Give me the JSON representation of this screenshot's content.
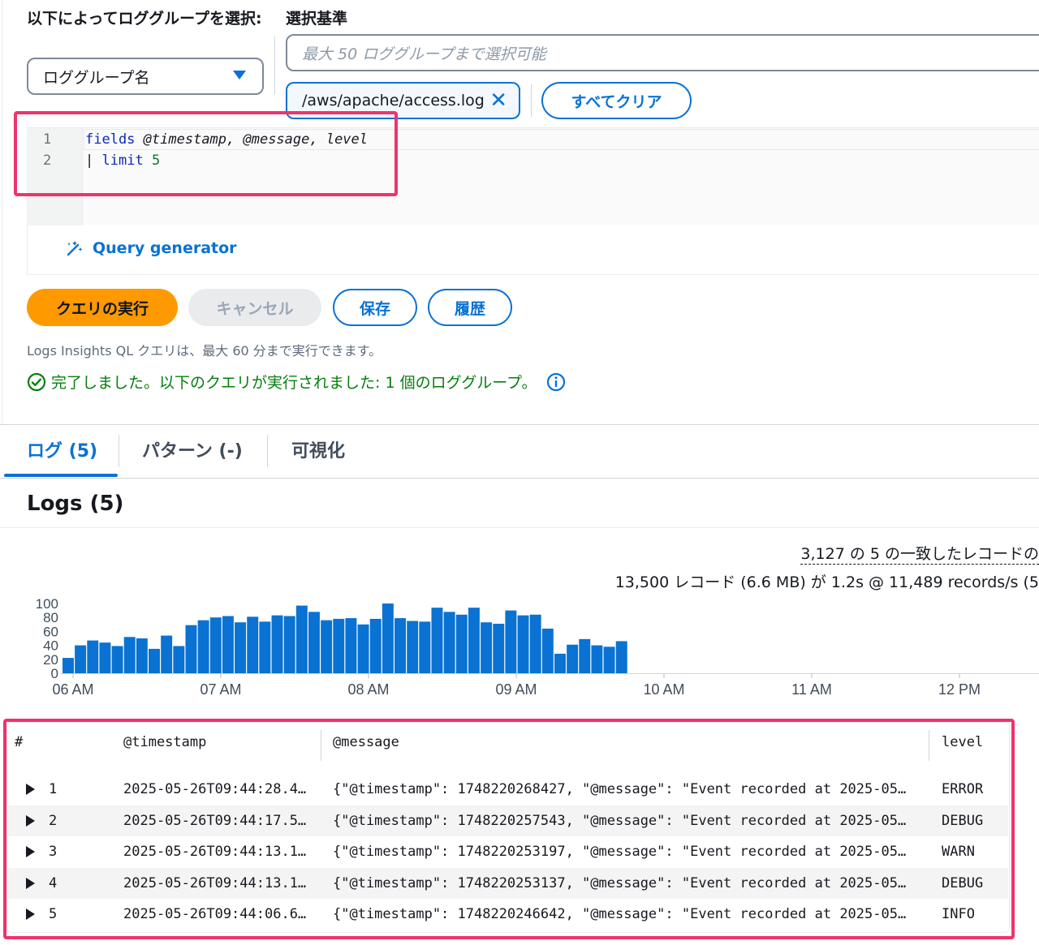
{
  "header": {
    "select_by_label": "以下によってロググループを選択:",
    "selection_criteria_label": "選択基準",
    "select_value": "ロググループ名",
    "search_placeholder": "最大 50 ロググループまで選択可能",
    "token_label": "/aws/apache/access.log",
    "clear_all_label": "すべてクリア"
  },
  "editor": {
    "line_numbers": [
      "1",
      "2"
    ],
    "line1": {
      "keyword": "fields",
      "args": "@timestamp, @message, level"
    },
    "line2": {
      "pipe": "|",
      "keyword": "limit",
      "value": "5"
    },
    "query_generator_label": "Query generator"
  },
  "actions": {
    "run_label": "クエリの実行",
    "cancel_label": "キャンセル",
    "save_label": "保存",
    "history_label": "履歴"
  },
  "hint_text": "Logs Insights QL クエリは、最大 60 分まで実行できます。",
  "status": {
    "message": "完了しました。以下のクエリが実行されました: 1 個のロググループ。",
    "color": "#037f0c"
  },
  "tabs": [
    {
      "label": "ログ (5)",
      "active": true
    },
    {
      "label": "パターン (-)",
      "active": false
    },
    {
      "label": "可視化",
      "active": false
    }
  ],
  "logs": {
    "title": "Logs (5)",
    "summary_line1": "3,127 の 5 の一致したレコードの",
    "summary_line2": "13,500 レコード (6.6 MB) が 1.2s @ 11,489 records/s (5"
  },
  "chart_data": {
    "type": "bar",
    "y_ticks": [
      "100",
      "80",
      "60",
      "40",
      "20",
      "0"
    ],
    "ylim": [
      0,
      100
    ],
    "x_ticks": [
      "06 AM",
      "07 AM",
      "08 AM",
      "09 AM",
      "10 AM",
      "11 AM",
      "12 PM"
    ],
    "values": [
      22,
      40,
      47,
      44,
      39,
      52,
      50,
      35,
      54,
      39,
      69,
      76,
      80,
      82,
      73,
      81,
      74,
      83,
      82,
      97,
      88,
      76,
      78,
      79,
      70,
      78,
      100,
      79,
      75,
      74,
      94,
      88,
      84,
      94,
      73,
      71,
      90,
      83,
      84,
      64,
      28,
      41,
      49,
      40,
      38,
      46
    ],
    "bar_color": "#0972d3",
    "grid": false
  },
  "table": {
    "columns": [
      "#",
      "@timestamp",
      "@message",
      "level"
    ],
    "rows": [
      {
        "index": "1",
        "timestamp": "2025-05-26T09:44:28.4…",
        "message": "{\"@timestamp\": 1748220268427, \"@message\": \"Event recorded at 2025-05…",
        "level": "ERROR"
      },
      {
        "index": "2",
        "timestamp": "2025-05-26T09:44:17.5…",
        "message": "{\"@timestamp\": 1748220257543, \"@message\": \"Event recorded at 2025-05…",
        "level": "DEBUG"
      },
      {
        "index": "3",
        "timestamp": "2025-05-26T09:44:13.1…",
        "message": "{\"@timestamp\": 1748220253197, \"@message\": \"Event recorded at 2025-05…",
        "level": "WARN"
      },
      {
        "index": "4",
        "timestamp": "2025-05-26T09:44:13.1…",
        "message": "{\"@timestamp\": 1748220253137, \"@message\": \"Event recorded at 2025-05…",
        "level": "DEBUG"
      },
      {
        "index": "5",
        "timestamp": "2025-05-26T09:44:06.6…",
        "message": "{\"@timestamp\": 1748220246642, \"@message\": \"Event recorded at 2025-05…",
        "level": "INFO"
      }
    ]
  },
  "colors": {
    "accent": "#0972d3",
    "primary_button": "#ff9900",
    "highlight_annotation": "#f0336b"
  }
}
